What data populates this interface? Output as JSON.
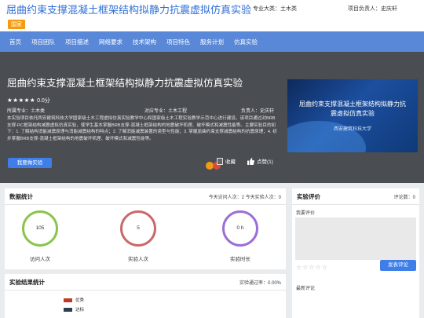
{
  "header": {
    "title": "屈曲约束支撑混凝土框架结构拟静力抗震虚拟仿真实验",
    "tag": "国家",
    "major": "专业大类：土木类",
    "lead": "项目负责人：史庆轩"
  },
  "nav": {
    "items": [
      "首页",
      "项目团队",
      "项目描述",
      "网络要求",
      "技术架构",
      "项目特色",
      "服务计划",
      "仿真实验"
    ]
  },
  "hero": {
    "title": "屈曲约束支撑混凝土框架结构拟静力抗震虚拟仿真实验",
    "stars": "★★★★★",
    "score": "0.0分",
    "category": "所属专业：土木类",
    "corr_major": "对应专业：土木工程",
    "leader": "负责人：史庆轩",
    "description": "本实验项目依托西安建筑科技大学国家级土木工程虚拟仿真实验教学中心和国家级土木工程实验教学示范中心进行建设。该项目通过对BRB支撑-RC框架结构减震虚拟仿真实验，使学生基本掌握BRB支撑-混凝土框架结构的地震破坏机理、破坏模式和减震性能等。主要实验目的如下：1. 了解结构消能减震原理与消能减震结构的特点；2. 了解消能减震装置的类型与性能；3. 掌握屈曲约束支撑减震结构的抗震原理；4. 初步掌握BRB支撑-混凝土框架结构的地震破坏机理、破坏模式和减震性能等。",
    "button": "我要做实验",
    "favorite": "收藏",
    "like": "点赞(1)",
    "banner": {
      "line1": "屈曲约束支撑混凝土框架结构拟静力抗",
      "line2": "震虚拟仿真实验",
      "line3": "西安建筑科技大学"
    }
  },
  "stats": {
    "title": "数据统计",
    "today": "今天访问人次：2 今天实验人次：0",
    "circles": [
      {
        "value": "105",
        "label": "访问人次",
        "color": "#8cc44b"
      },
      {
        "value": "5",
        "label": "实验人次",
        "color": "#c96a6a"
      },
      {
        "value": "0 h",
        "label": "实验时长",
        "color": "#9a6fd6"
      }
    ]
  },
  "results": {
    "title": "实验结果统计",
    "rate": "实验通过率：0.00%",
    "legend": [
      {
        "label": "优秀",
        "color": "#c0392b"
      },
      {
        "label": "达标",
        "color": "#2c3e50"
      }
    ]
  },
  "evaluation": {
    "title": "实验评价",
    "count": "评论数：0",
    "my_label": "我要评价",
    "stars": "☆☆☆☆☆",
    "send": "发表评论",
    "latest": "最新评论"
  }
}
